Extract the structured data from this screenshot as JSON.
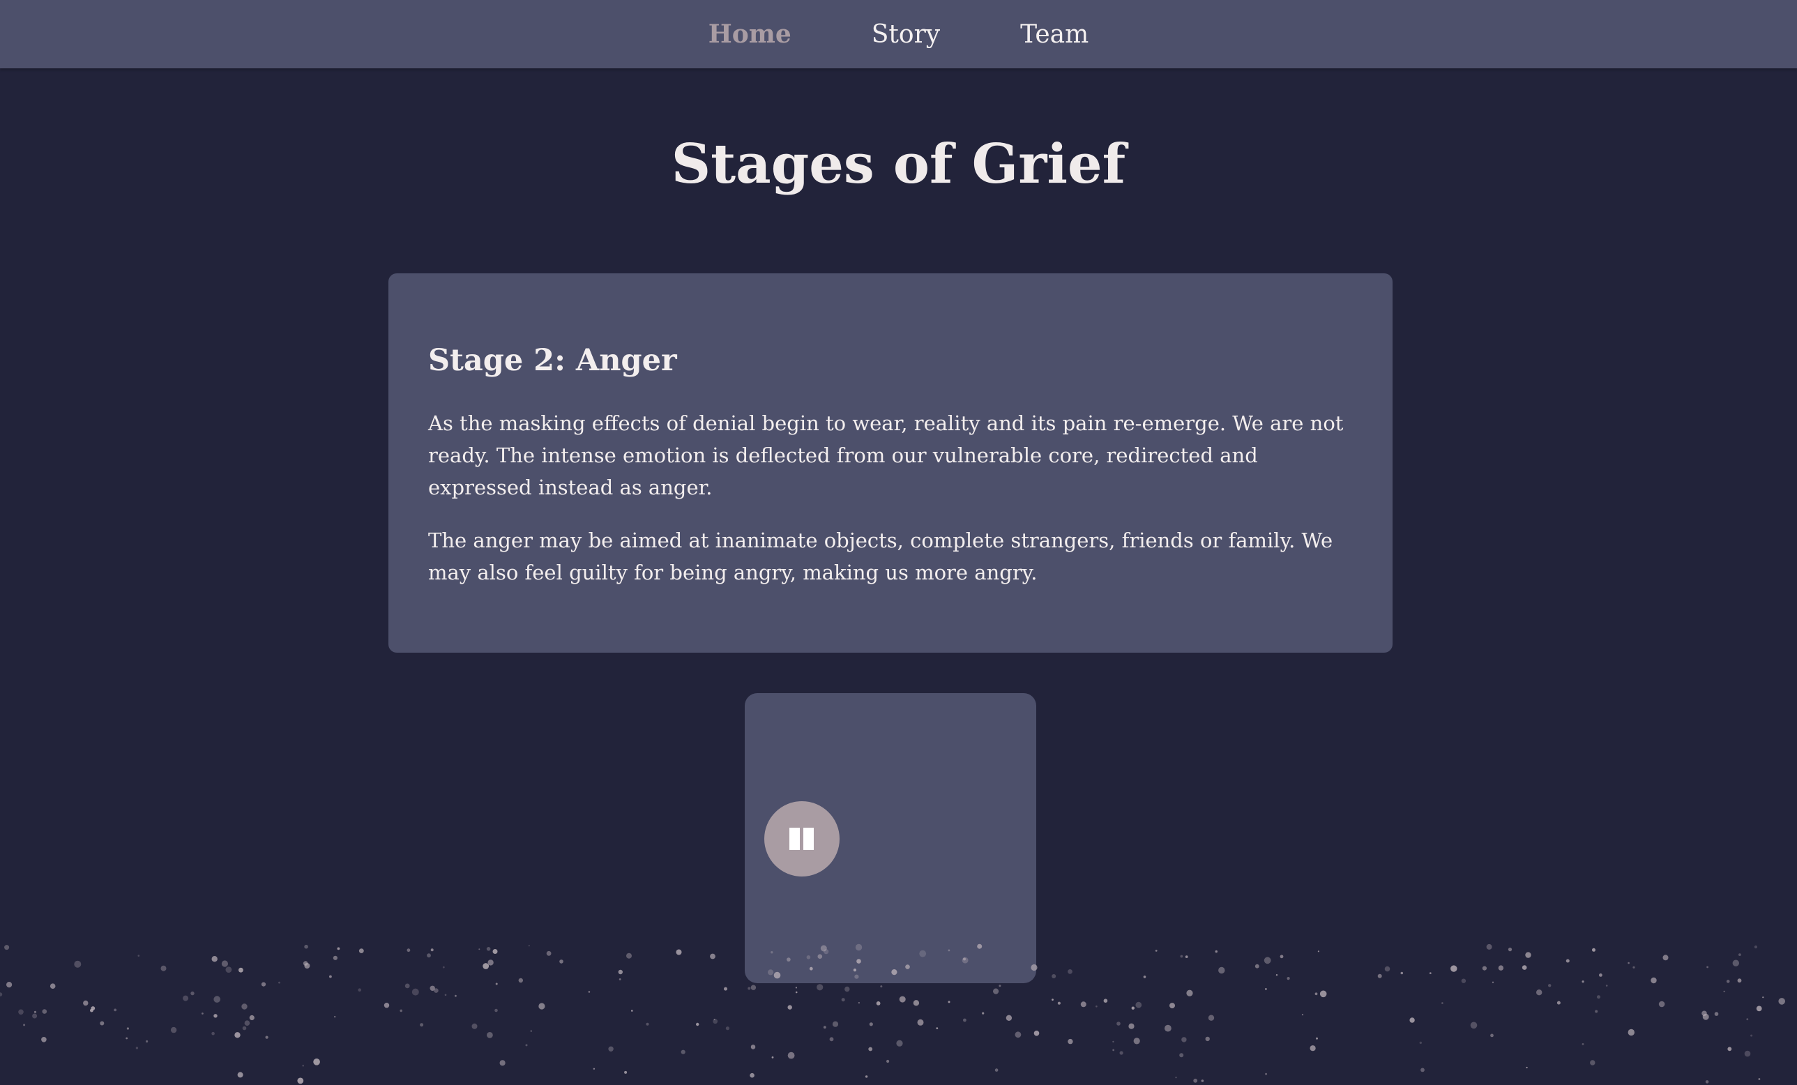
{
  "nav": {
    "items": [
      {
        "label": "Home",
        "active": true
      },
      {
        "label": "Story",
        "active": false
      },
      {
        "label": "Team",
        "active": false
      }
    ]
  },
  "page": {
    "title": "Stages of Grief"
  },
  "stage_card": {
    "heading": "Stage 2: Anger",
    "paragraphs": [
      "As the masking effects of denial begin to wear, reality and its pain re-emerge. We are not ready. The intense emotion is deflected from our vulnerable core, redirected and expressed instead as anger.",
      "The anger may be aimed at inanimate objects, complete strangers, friends or family. We may also feel guilty for being angry, making us more angry."
    ]
  },
  "player": {
    "button_icon": "pause-icon",
    "state": "playing"
  },
  "colors": {
    "background": "#22233a",
    "panel": "#4d506b",
    "accent": "#a99ca3",
    "text": "#f2eeee"
  }
}
